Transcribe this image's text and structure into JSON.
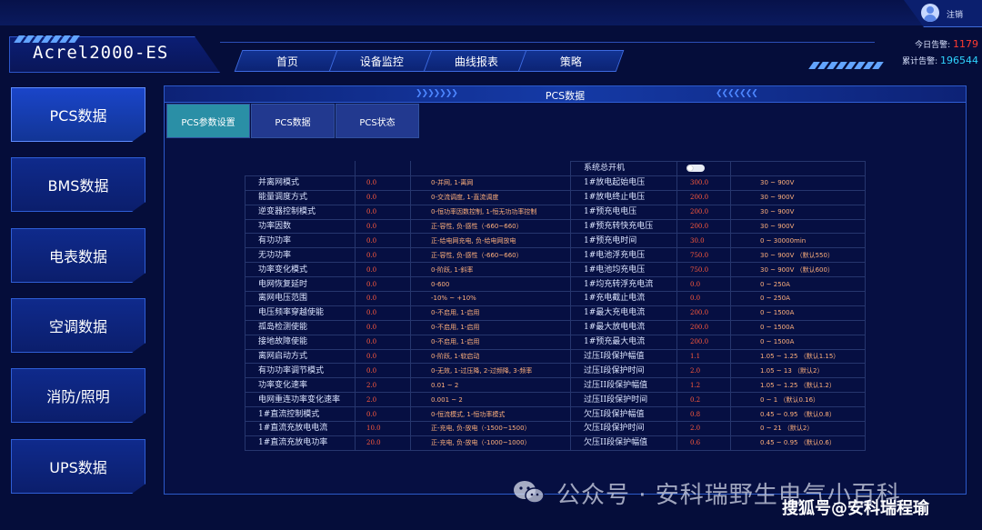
{
  "topbar": {
    "logout_label": "注销"
  },
  "brand": {
    "title": "Acrel2000-ES"
  },
  "nav": {
    "items": [
      "首页",
      "设备监控",
      "曲线报表",
      "策略"
    ]
  },
  "alarms": {
    "today_label": "今日告警:",
    "today_value": "1179",
    "total_label": "累计告警:",
    "total_value": "196544",
    "today_color": "#ff3b30",
    "total_color": "#2fd4ff"
  },
  "sidebar": {
    "items": [
      "PCS数据",
      "BMS数据",
      "电表数据",
      "空调数据",
      "消防/照明",
      "UPS数据"
    ]
  },
  "panel": {
    "title": "PCS数据",
    "tabs": [
      "PCS参数设置",
      "PCS数据",
      "PCS状态"
    ],
    "switch_label": "系统总开机",
    "rows": [
      [
        "并离网模式",
        "0.0",
        "0-并网, 1-离网",
        "1#放电起始电压",
        "300.0",
        "30 ~ 900V"
      ],
      [
        "能量调度方式",
        "0.0",
        "0-交流调度, 1-直流调度",
        "1#放电终止电压",
        "200.0",
        "30 ~ 900V"
      ],
      [
        "逆变器控制模式",
        "0.0",
        "0-恒功率因数控制, 1-恒无功功率控制",
        "1#预充电电压",
        "200.0",
        "30 ~ 900V"
      ],
      [
        "功率因数",
        "0.0",
        "正-容性, 负-感性（-660~660）",
        "1#预充转快充电压",
        "200.0",
        "30 ~ 900V"
      ],
      [
        "有功功率",
        "0.0",
        "正-给电网充电, 负-给电网放电",
        "1#预充电时间",
        "30.0",
        "0 ~ 30000min"
      ],
      [
        "无功功率",
        "0.0",
        "正-容性, 负-感性（-660~660）",
        "1#电池浮充电压",
        "750.0",
        "30 ~ 900V （默认550）"
      ],
      [
        "功率变化模式",
        "0.0",
        "0-阶跃, 1-斜率",
        "1#电池均充电压",
        "750.0",
        "30 ~ 900V （默认600）"
      ],
      [
        "电网恢复延时",
        "0.0",
        "0-600",
        "1#均充转浮充电流",
        "0.0",
        "0 ~ 250A"
      ],
      [
        "离网电压范围",
        "0.0",
        "-10% ~ +10%",
        "1#充电截止电流",
        "0.0",
        "0 ~ 250A"
      ],
      [
        "电压频率穿越使能",
        "0.0",
        "0-不启用, 1-启用",
        "1#最大充电电流",
        "200.0",
        "0 ~ 1500A"
      ],
      [
        "孤岛检测使能",
        "0.0",
        "0-不启用, 1-启用",
        "1#最大放电电流",
        "200.0",
        "0 ~ 1500A"
      ],
      [
        "接地故障使能",
        "0.0",
        "0-不启用, 1-启用",
        "1#预充最大电流",
        "200.0",
        "0 ~ 1500A"
      ],
      [
        "离网启动方式",
        "0.0",
        "0-阶跃, 1-软启动",
        "过压I段保护幅值",
        "1.1",
        "1.05 ~ 1.25 （默认1.15）"
      ],
      [
        "有功功率调节模式",
        "0.0",
        "0-无效, 1-过压降, 2-过频降, 3-频率",
        "过压I段保护时间",
        "2.0",
        "1.05 ~ 13 （默认2）"
      ],
      [
        "功率变化速率",
        "2.0",
        "0.01 ~ 2",
        "过压II段保护幅值",
        "1.2",
        "1.05 ~ 1.25 （默认1.2）"
      ],
      [
        "电网重连功率变化速率",
        "2.0",
        "0.001 ~ 2",
        "过压II段保护时间",
        "0.2",
        "0 ~ 1 （默认0.16）"
      ],
      [
        "1#直流控制模式",
        "0.0",
        "0-恒流模式, 1-恒功率模式",
        "欠压I段保护幅值",
        "0.8",
        "0.45 ~ 0.95 （默认0.8）"
      ],
      [
        "1#直流充放电电流",
        "10.0",
        "正-充电, 负-放电（-1500~1500）",
        "欠压I段保护时间",
        "2.0",
        "0 ~ 21 （默认2）"
      ],
      [
        "1#直流充放电功率",
        "20.0",
        "正-充电, 负-放电（-1000~1000）",
        "欠压II段保护幅值",
        "0.6",
        "0.45 ~ 0.95 （默认0.6）"
      ]
    ]
  },
  "watermarks": {
    "line1": "公众号 · 安科瑞野生电气小百科",
    "line2": "搜狐号@安科瑞程瑜"
  }
}
